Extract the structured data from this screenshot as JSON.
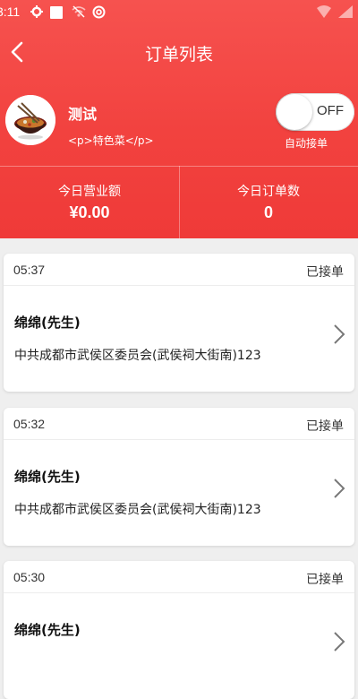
{
  "status_bar": {
    "time": "3:11"
  },
  "nav": {
    "title": "订单列表"
  },
  "shop": {
    "name": "测试",
    "description": "<p>特色菜</p>",
    "toggle_state": "OFF",
    "auto_accept_label": "自动接单"
  },
  "stats": {
    "today_revenue_label": "今日营业额",
    "today_revenue_value": "¥0.00",
    "today_orders_label": "今日订单数",
    "today_orders_value": "0"
  },
  "orders": [
    {
      "time": "05:37",
      "status": "已接单",
      "customer": "绵绵(先生)",
      "address": "中共成都市武侯区委员会(武侯祠大街南)123"
    },
    {
      "time": "05:32",
      "status": "已接单",
      "customer": "绵绵(先生)",
      "address": "中共成都市武侯区委员会(武侯祠大街南)123"
    },
    {
      "time": "05:30",
      "status": "已接单",
      "customer": "绵绵(先生)",
      "address": ""
    }
  ],
  "colors": {
    "header_red": "#f2423f",
    "background": "#efefef"
  }
}
